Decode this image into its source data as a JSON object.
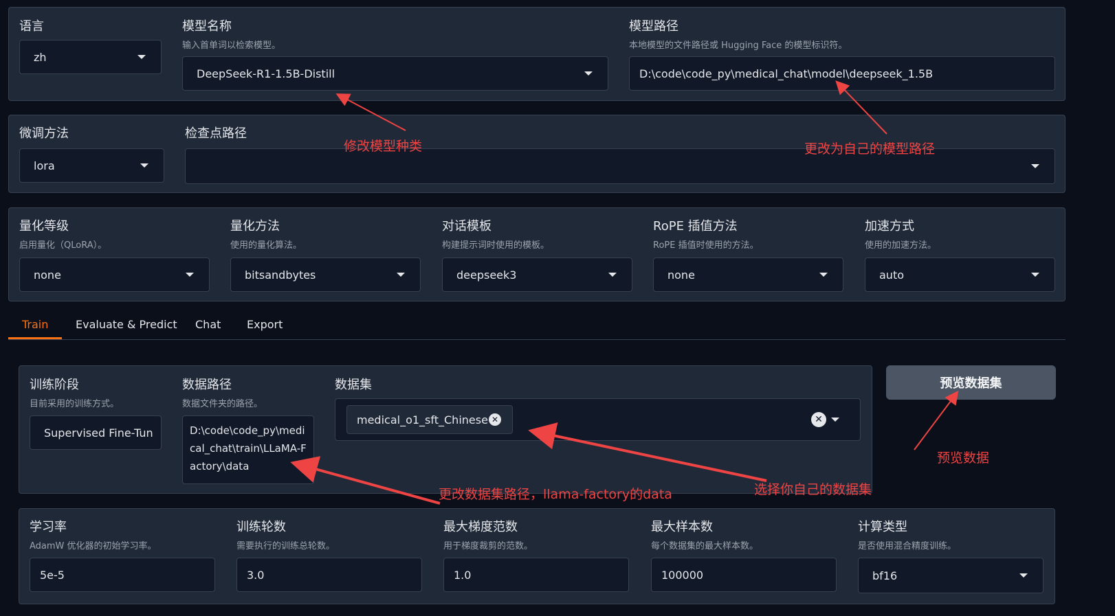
{
  "top": {
    "lang": {
      "label": "语言",
      "value": "zh"
    },
    "model_name": {
      "label": "模型名称",
      "info": "输入首单词以检索模型。",
      "value": "DeepSeek-R1-1.5B-Distill"
    },
    "model_path": {
      "label": "模型路径",
      "info": "本地模型的文件路径或 Hugging Face 的模型标识符。",
      "value": "D:\\code\\code_py\\medical_chat\\model\\deepseek_1.5B"
    }
  },
  "row2": {
    "finetune": {
      "label": "微调方法",
      "value": "lora"
    },
    "checkpoint": {
      "label": "检查点路径",
      "value": ""
    }
  },
  "row3": {
    "quant_bit": {
      "label": "量化等级",
      "info": "启用量化（QLoRA）。",
      "value": "none"
    },
    "quant_method": {
      "label": "量化方法",
      "info": "使用的量化算法。",
      "value": "bitsandbytes"
    },
    "template": {
      "label": "对话模板",
      "info": "构建提示词时使用的模板。",
      "value": "deepseek3"
    },
    "rope": {
      "label": "RoPE 插值方法",
      "info": "RoPE 插值时使用的方法。",
      "value": "none"
    },
    "booster": {
      "label": "加速方式",
      "info": "使用的加速方法。",
      "value": "auto"
    }
  },
  "tabs": [
    "Train",
    "Evaluate & Predict",
    "Chat",
    "Export"
  ],
  "train": {
    "stage": {
      "label": "训练阶段",
      "info": "目前采用的训练方式。",
      "value": "Supervised Fine-Tun"
    },
    "dataset_dir": {
      "label": "数据路径",
      "info": "数据文件夹的路径。",
      "value": "D:\\code\\code_py\\medical_chat\\train\\LLaMA-Factory\\data"
    },
    "dataset": {
      "label": "数据集",
      "chip": "medical_o1_sft_Chinese"
    },
    "preview_button": "预览数据集"
  },
  "row5": {
    "lr": {
      "label": "学习率",
      "info": "AdamW 优化器的初始学习率。",
      "value": "5e-5"
    },
    "epochs": {
      "label": "训练轮数",
      "info": "需要执行的训练总轮数。",
      "value": "3.0"
    },
    "max_grad_norm": {
      "label": "最大梯度范数",
      "info": "用于梯度裁剪的范数。",
      "value": "1.0"
    },
    "max_samples": {
      "label": "最大样本数",
      "info": "每个数据集的最大样本数。",
      "value": "100000"
    },
    "compute_type": {
      "label": "计算类型",
      "info": "是否使用混合精度训练。",
      "value": "bf16"
    }
  },
  "annotations": {
    "model_kind": "修改模型种类",
    "model_path": "更改为自己的模型路径",
    "dataset_path": "更改数据集路径，llama-factory的data",
    "dataset": "选择你自己的数据集",
    "preview": "预览数据"
  },
  "colors": {
    "accent": "#f97316",
    "annotation": "#ef4444",
    "panel": "#1f2937",
    "background": "#0b0f19"
  },
  "icons": [
    "caret-down-icon",
    "close-icon",
    "arrow-annotation"
  ]
}
